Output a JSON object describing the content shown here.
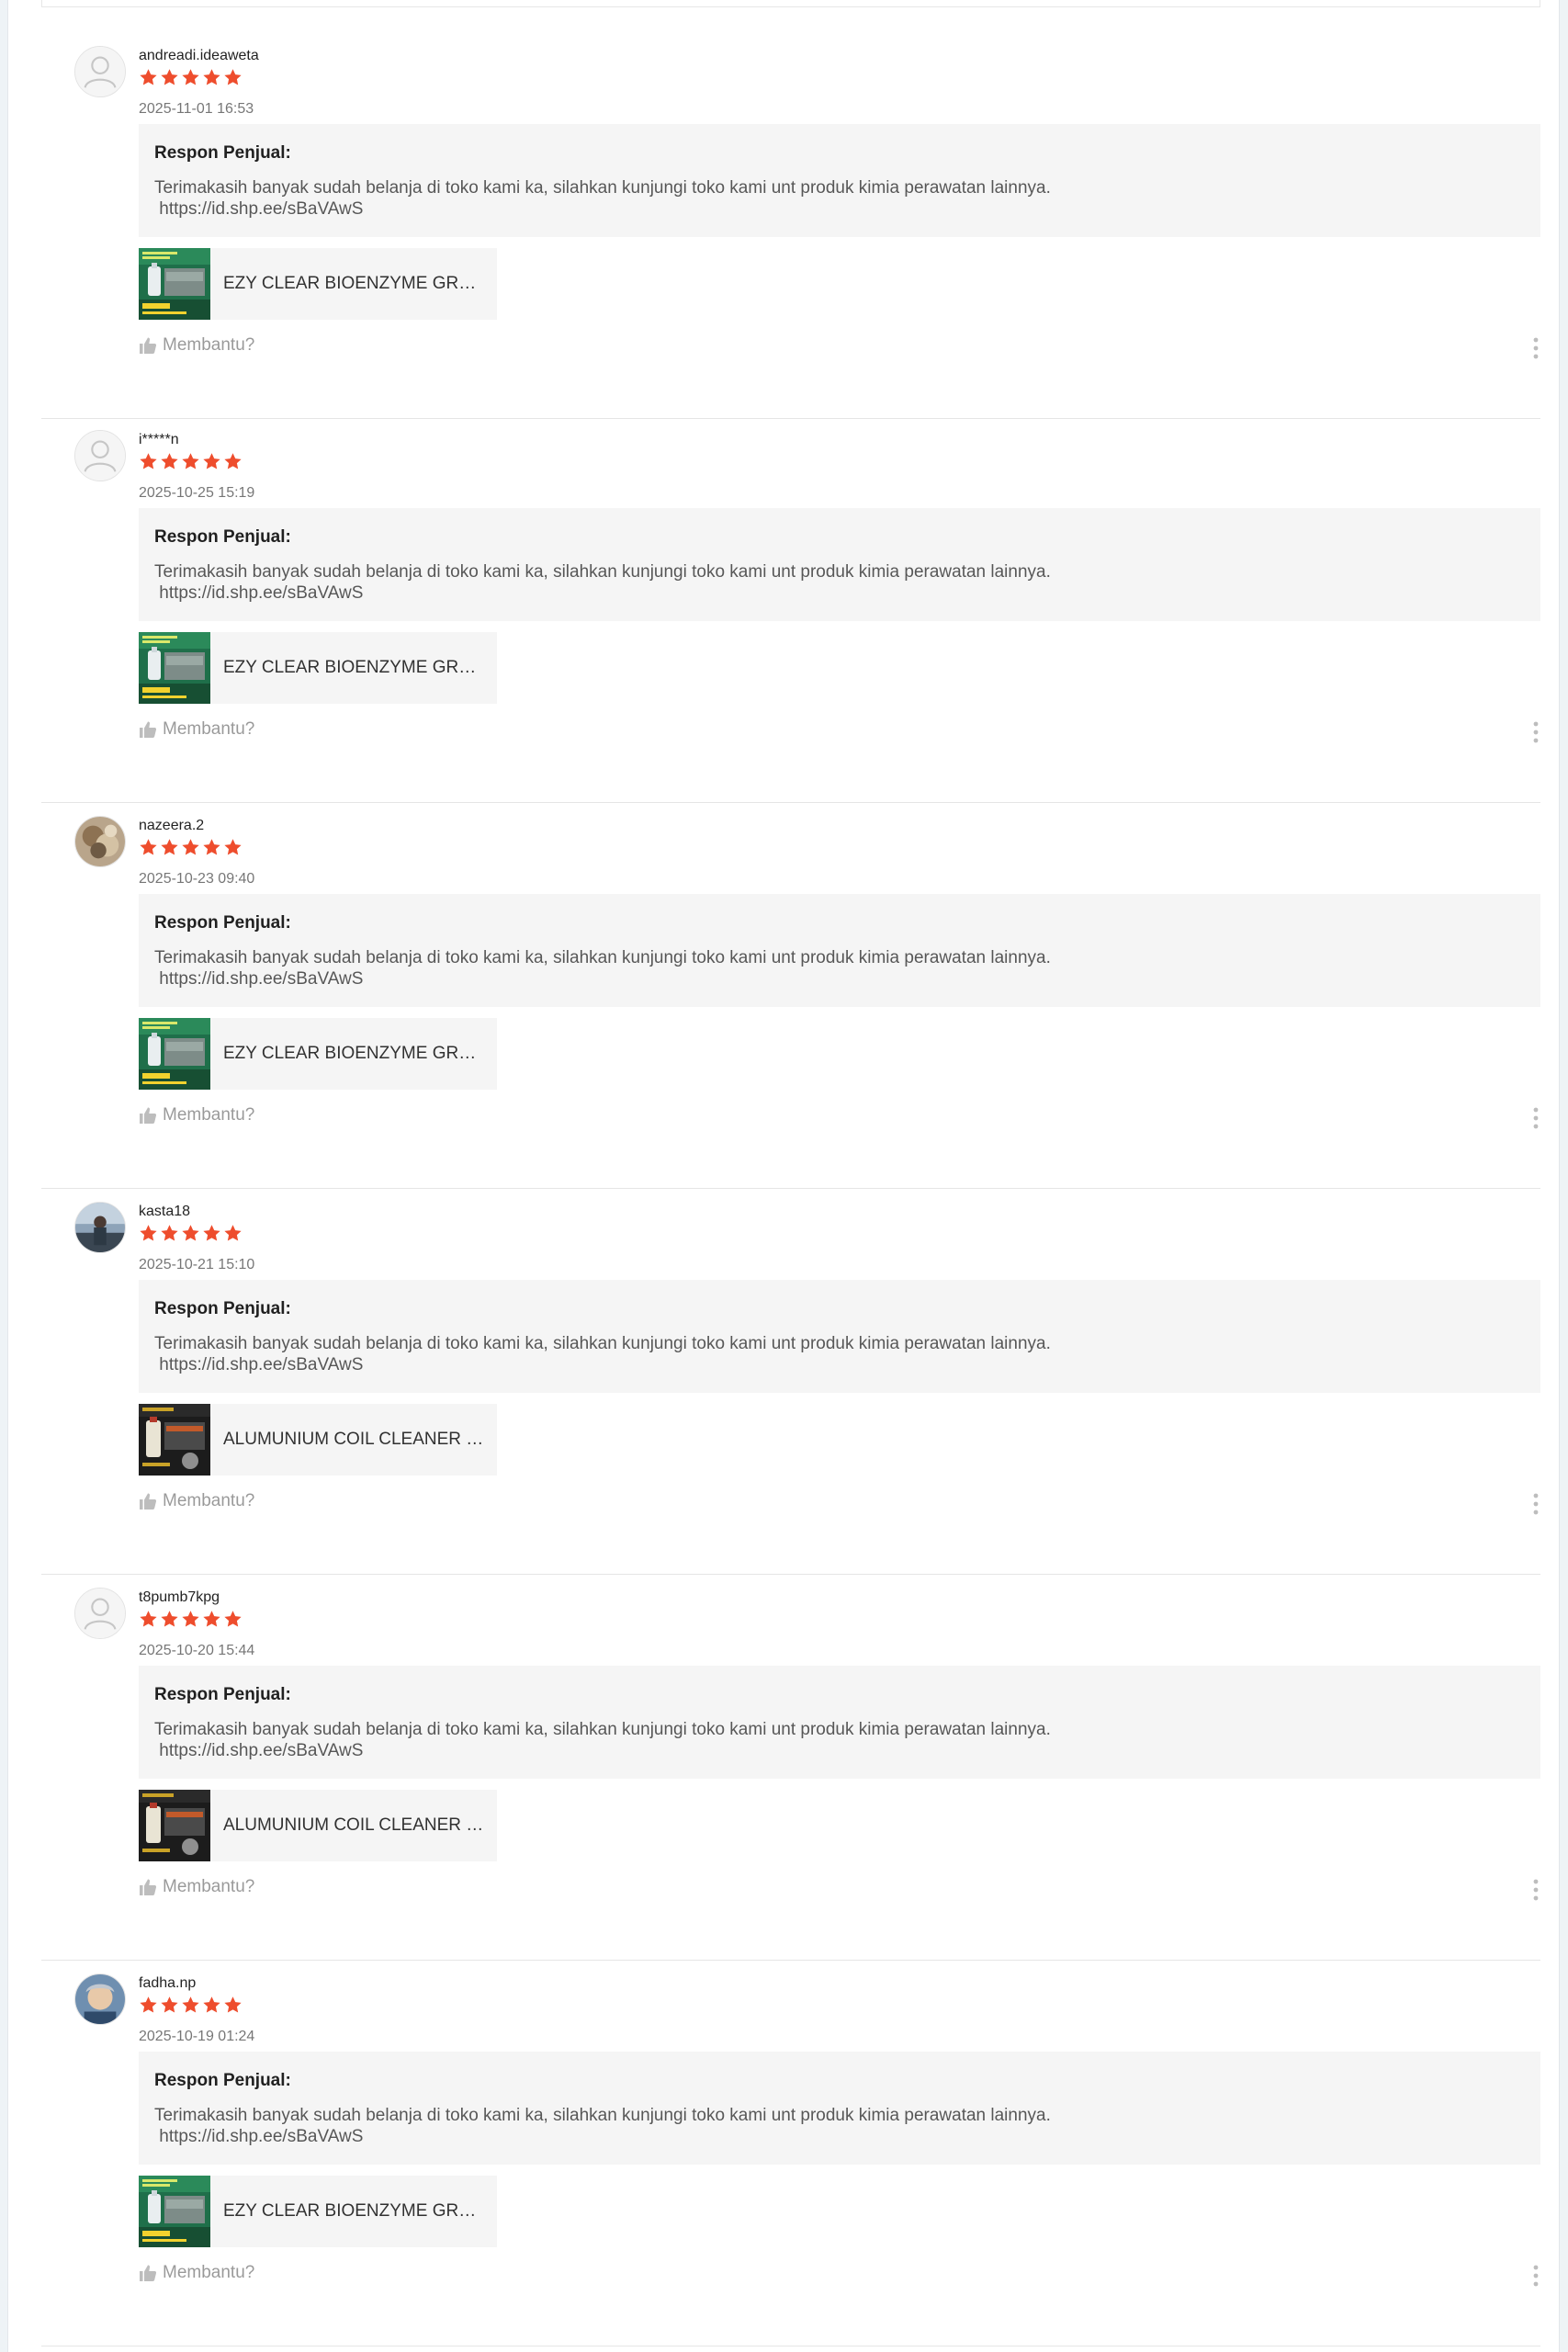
{
  "reviews": [
    {
      "username": "andreadi.ideaweta",
      "avatar": "default-user-icon",
      "rating": 5,
      "date": "2025-11-01 16:53",
      "response_title": "Respon Penjual:",
      "response_text": "Terimakasih banyak sudah belanja di toko kami ka, silahkan kunjungi toko kami unt produk kimia perawatan lainnya.\n https://id.shp.ee/sBaVAwS",
      "product_name": "EZY CLEAR BIOENZYME GREASE EATER",
      "product_thumb": "green-bottle-thumbnail",
      "helpful_label": "Membantu?"
    },
    {
      "username": "i*****n",
      "avatar": "default-user-icon",
      "rating": 5,
      "date": "2025-10-25 15:19",
      "response_title": "Respon Penjual:",
      "response_text": "Terimakasih banyak sudah belanja di toko kami ka, silahkan kunjungi toko kami unt produk kimia perawatan lainnya.\n https://id.shp.ee/sBaVAwS",
      "product_name": "EZY CLEAR BIOENZYME GREASE EATER",
      "product_thumb": "green-bottle-thumbnail",
      "helpful_label": "Membantu?"
    },
    {
      "username": "nazeera.2",
      "avatar": "photo-avatar",
      "rating": 5,
      "date": "2025-10-23 09:40",
      "response_title": "Respon Penjual:",
      "response_text": "Terimakasih banyak sudah belanja di toko kami ka, silahkan kunjungi toko kami unt produk kimia perawatan lainnya.\n https://id.shp.ee/sBaVAwS",
      "product_name": "EZY CLEAR BIOENZYME GREASE EATER",
      "product_thumb": "green-bottle-thumbnail",
      "helpful_label": "Membantu?"
    },
    {
      "username": "kasta18",
      "avatar": "photo-avatar",
      "rating": 5,
      "date": "2025-10-21 15:10",
      "response_title": "Respon Penjual:",
      "response_text": "Terimakasih banyak sudah belanja di toko kami ka, silahkan kunjungi toko kami unt produk kimia perawatan lainnya.\n https://id.shp.ee/sBaVAwS",
      "product_name": "ALUMUNIUM COIL CLEANER / PEMBERSIH",
      "product_thumb": "coil-cleaner-thumbnail",
      "helpful_label": "Membantu?"
    },
    {
      "username": "t8pumb7kpg",
      "avatar": "default-user-icon",
      "rating": 5,
      "date": "2025-10-20 15:44",
      "response_title": "Respon Penjual:",
      "response_text": "Terimakasih banyak sudah belanja di toko kami ka, silahkan kunjungi toko kami unt produk kimia perawatan lainnya.\n https://id.shp.ee/sBaVAwS",
      "product_name": "ALUMUNIUM COIL CLEANER / PEMBERSIH",
      "product_thumb": "coil-cleaner-thumbnail",
      "helpful_label": "Membantu?"
    },
    {
      "username": "fadha.np",
      "avatar": "photo-avatar",
      "rating": 5,
      "date": "2025-10-19 01:24",
      "response_title": "Respon Penjual:",
      "response_text": "Terimakasih banyak sudah belanja di toko kami ka, silahkan kunjungi toko kami unt produk kimia perawatan lainnya.\n https://id.shp.ee/sBaVAwS",
      "product_name": "EZY CLEAR BIOENZYME GREASE EATER",
      "product_thumb": "green-bottle-thumbnail",
      "helpful_label": "Membantu?"
    }
  ],
  "colors": {
    "star": "#ee4d2d",
    "response_bg": "#f5f5f5",
    "muted_text": "#9e9e9e"
  }
}
